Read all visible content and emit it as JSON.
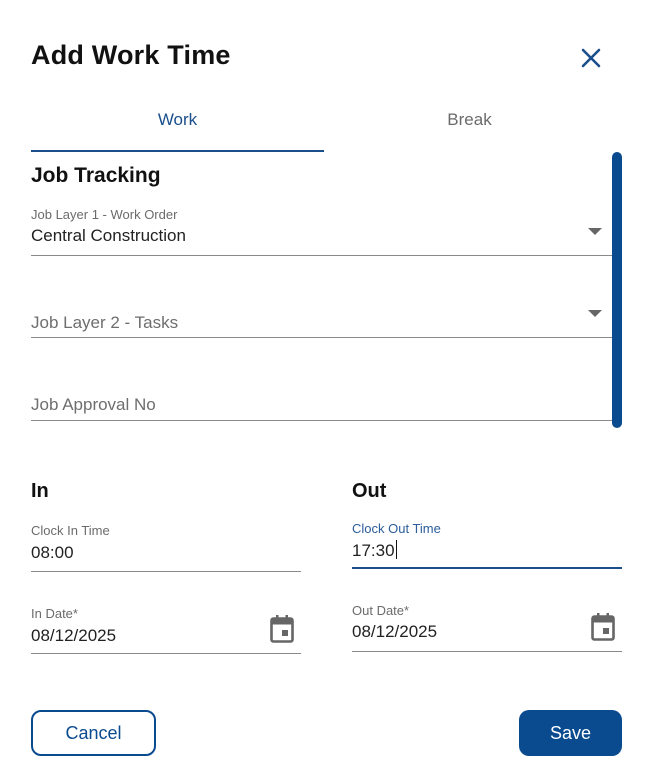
{
  "dialog": {
    "title": "Add Work Time",
    "close_icon": "close-icon"
  },
  "tabs": [
    {
      "label": "Work",
      "active": true
    },
    {
      "label": "Break",
      "active": false
    }
  ],
  "job_tracking": {
    "title": "Job Tracking",
    "layer1": {
      "label": "Job Layer 1 - Work Order",
      "value": "Central Construction"
    },
    "layer2": {
      "placeholder": "Job Layer 2 - Tasks"
    },
    "approval": {
      "placeholder": "Job Approval No"
    }
  },
  "in": {
    "title": "In",
    "clock_in": {
      "label": "Clock In Time",
      "value": "08:00"
    },
    "date": {
      "label": "In Date*",
      "value": "08/12/2025",
      "icon": "calendar-icon"
    }
  },
  "out": {
    "title": "Out",
    "clock_out": {
      "label": "Clock Out Time",
      "value": "17:30"
    },
    "date": {
      "label": "Out Date*",
      "value": "08/12/2025",
      "icon": "calendar-icon"
    }
  },
  "actions": {
    "cancel_label": "Cancel",
    "save_label": "Save"
  },
  "colors": {
    "primary": "#0a4a8f",
    "active_tab": "#1a4f8c",
    "muted_text": "#6b6b6b"
  }
}
